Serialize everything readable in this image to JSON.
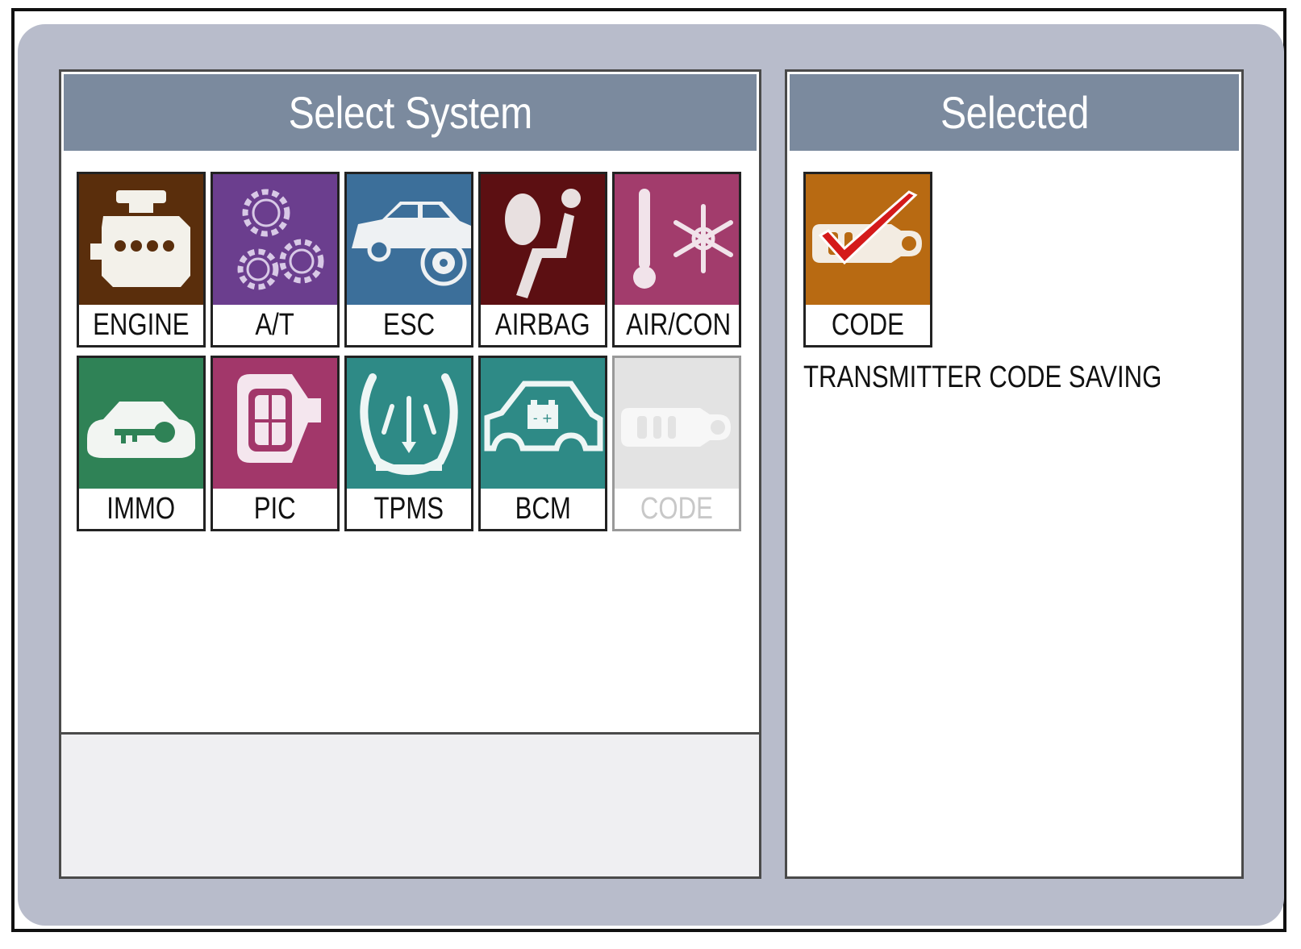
{
  "left_panel": {
    "title": "Select System",
    "systems": [
      {
        "label": "ENGINE",
        "icon": "engine-icon",
        "color": "#5a2e0c",
        "enabled": true
      },
      {
        "label": "A/T",
        "icon": "gears-icon",
        "color": "#6b3e8e",
        "enabled": true
      },
      {
        "label": "ESC",
        "icon": "car-brake-icon",
        "color": "#3c6f9a",
        "enabled": true
      },
      {
        "label": "AIRBAG",
        "icon": "airbag-seat-icon",
        "color": "#5c0f12",
        "enabled": true
      },
      {
        "label": "AIR/CON",
        "icon": "thermometer-snowflake-icon",
        "color": "#a23c6c",
        "enabled": true
      },
      {
        "label": "IMMO",
        "icon": "car-key-icon",
        "color": "#2f8256",
        "enabled": true
      },
      {
        "label": "PIC",
        "icon": "smart-key-icon",
        "color": "#a2376a",
        "enabled": true
      },
      {
        "label": "TPMS",
        "icon": "tire-pressure-icon",
        "color": "#2e8a86",
        "enabled": true
      },
      {
        "label": "BCM",
        "icon": "car-battery-icon",
        "color": "#2e8a86",
        "enabled": true
      },
      {
        "label": "CODE",
        "icon": "transmitter-code-icon",
        "color": "#e3e3e3",
        "enabled": false
      }
    ]
  },
  "right_panel": {
    "title": "Selected",
    "selected": {
      "label": "CODE",
      "icon": "transmitter-code-check-icon",
      "color": "#b86a12"
    },
    "description": "TRANSMITTER CODE SAVING"
  }
}
